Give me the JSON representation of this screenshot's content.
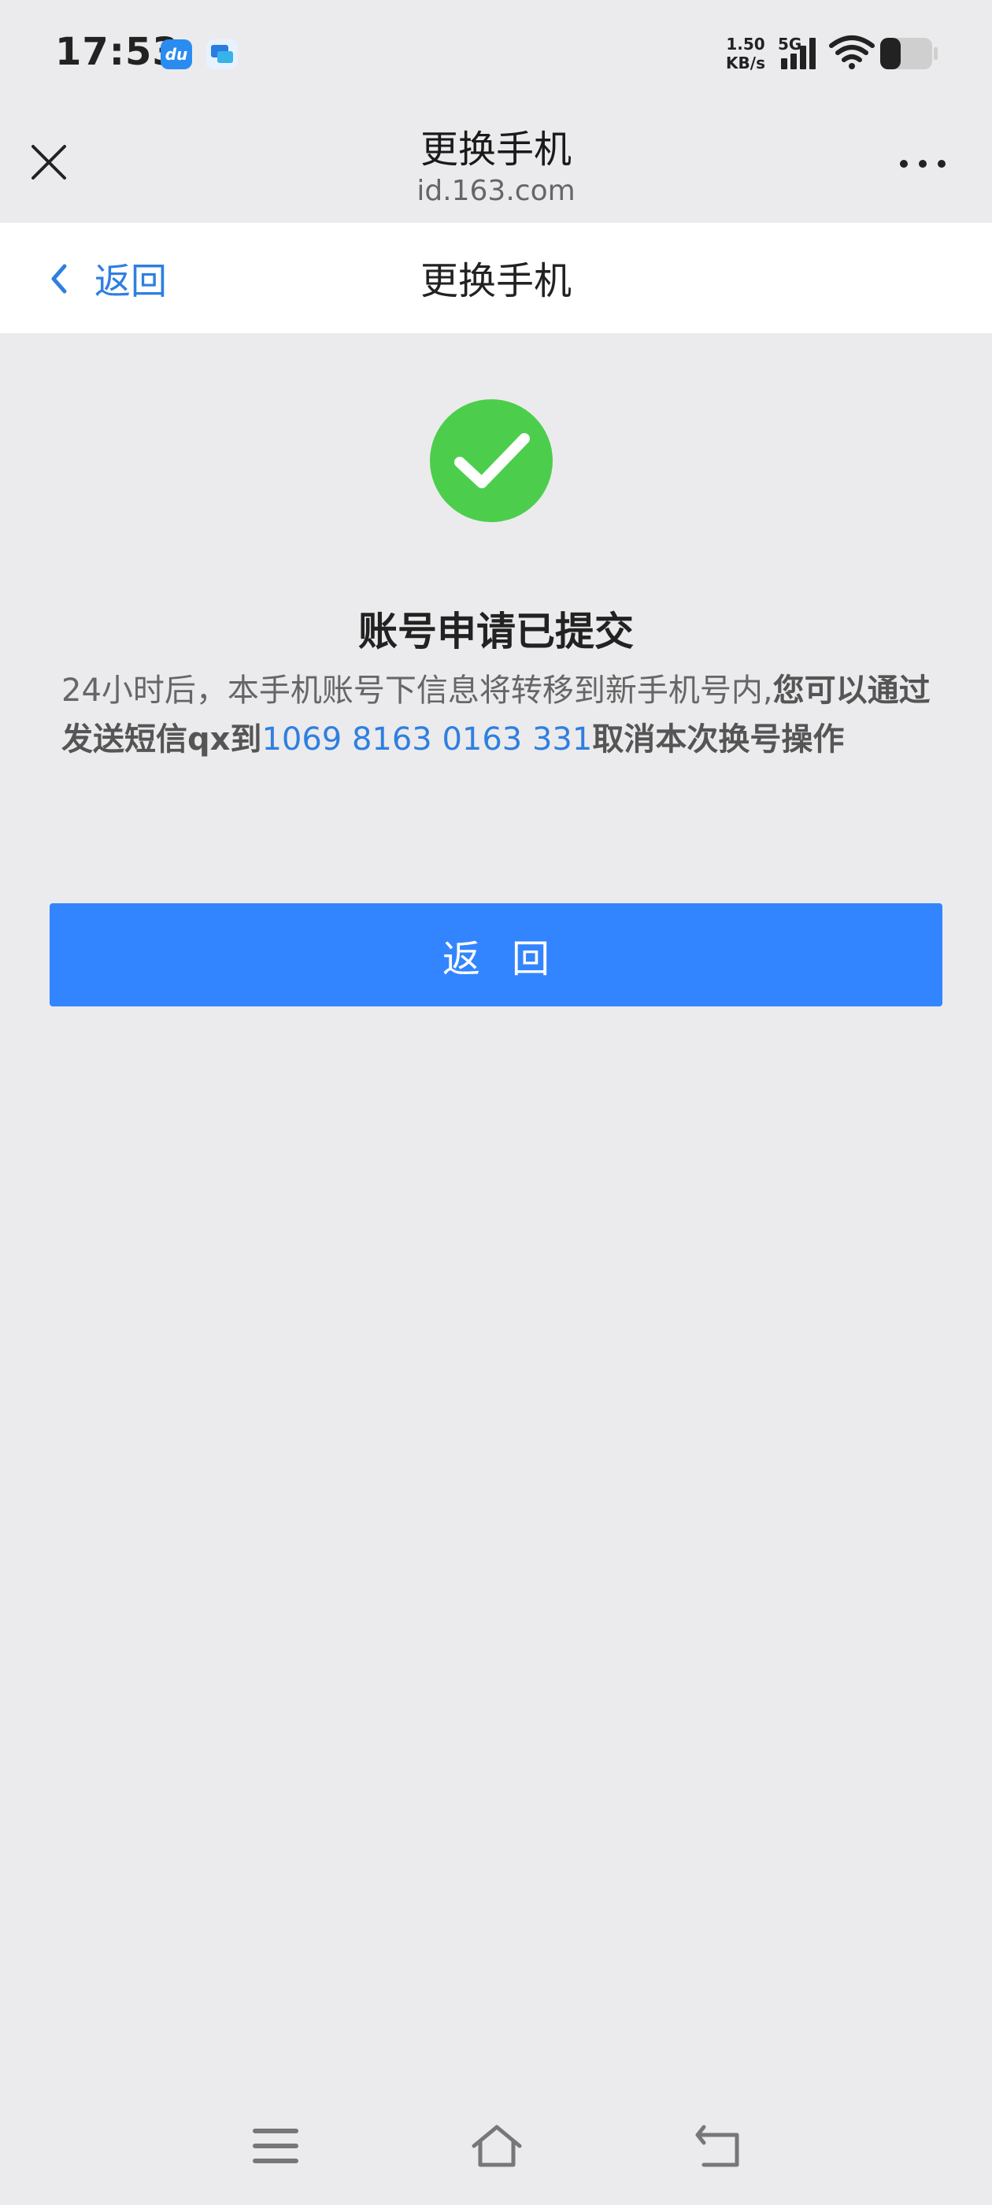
{
  "status_bar": {
    "time": "17:53",
    "net_speed_value": "1.50",
    "net_speed_unit": "KB/s",
    "network_type": "5G",
    "app_icon1_text": "du",
    "icons": [
      "du-app-icon",
      "message-app-icon",
      "signal-icon",
      "wifi-icon",
      "battery-icon"
    ]
  },
  "browser_header": {
    "title": "更换手机",
    "domain": "id.163.com"
  },
  "nav": {
    "back_label": "返回",
    "title": "更换手机"
  },
  "content": {
    "success_title": "账号申请已提交",
    "desc_part1": "24小时后，本手机账号下信息将转移到新手机号内,",
    "desc_part2": "您可以通过发送短信qx到",
    "desc_phone": "1069 8163 0163 331",
    "desc_part3": "取消本次换号操作",
    "button_label": "返回"
  },
  "colors": {
    "accent": "#3385ff",
    "link": "#2f7fe0",
    "success": "#4cce4c",
    "background": "#ebebed"
  }
}
